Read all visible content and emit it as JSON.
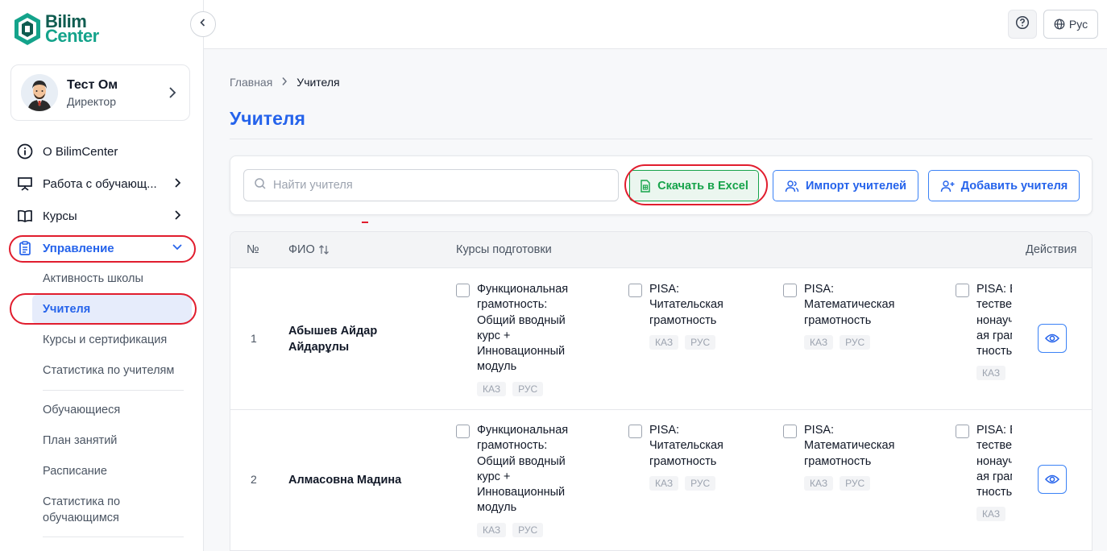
{
  "brand": {
    "line1": "Bilim",
    "line2": "Center"
  },
  "profile": {
    "name": "Тест Ом",
    "role": "Директор"
  },
  "nav": [
    {
      "label": "О BilimCenter",
      "icon": "info-icon"
    },
    {
      "label": "Работа с обучающ...",
      "icon": "presentation-icon"
    },
    {
      "label": "Курсы",
      "icon": "book-icon"
    },
    {
      "label": "Управление",
      "icon": "clipboard-icon"
    }
  ],
  "subnav": [
    {
      "label": "Активность школы"
    },
    {
      "label": "Учителя"
    },
    {
      "label": "Курсы и сертификация"
    },
    {
      "label": "Статистика по учителям"
    },
    {
      "label": "Обучающиеся"
    },
    {
      "label": "План занятий"
    },
    {
      "label": "Расписание"
    },
    {
      "label": "Статистика по обучающимся"
    }
  ],
  "topbar": {
    "lang": "Рус"
  },
  "breadcrumb": {
    "home": "Главная",
    "current": "Учителя"
  },
  "page_title": "Учителя",
  "search": {
    "placeholder": "Найти учителя",
    "value": ""
  },
  "actions": {
    "excel": "Скачать в Excel",
    "import": "Импорт учителей",
    "add": "Добавить учителя"
  },
  "table": {
    "headers": {
      "num": "№",
      "name": "ФИО",
      "courses": "Курсы подготовки",
      "actions": "Действия"
    },
    "courses": [
      {
        "title": "Функциональная грамотность: Общий вводный курс + Инновационный модуль"
      },
      {
        "title": "PISA: Читательская грамотность"
      },
      {
        "title": "PISA: Математическая грамотность"
      },
      {
        "title": "PISA: Естественнонаучная грамотность"
      }
    ],
    "tag_kaz": "КАЗ",
    "tag_rus": "РУС",
    "rows": [
      {
        "num": "1",
        "name": "Абышев Айдар Айдарұлы"
      },
      {
        "num": "2",
        "name": "Алмасовна Мадина"
      }
    ]
  },
  "colors": {
    "accent": "#2563eb",
    "excel": "#16a34a",
    "highlight": "#e11d2e",
    "brand_dark": "#0f5c50",
    "brand_light": "#14a38b"
  }
}
